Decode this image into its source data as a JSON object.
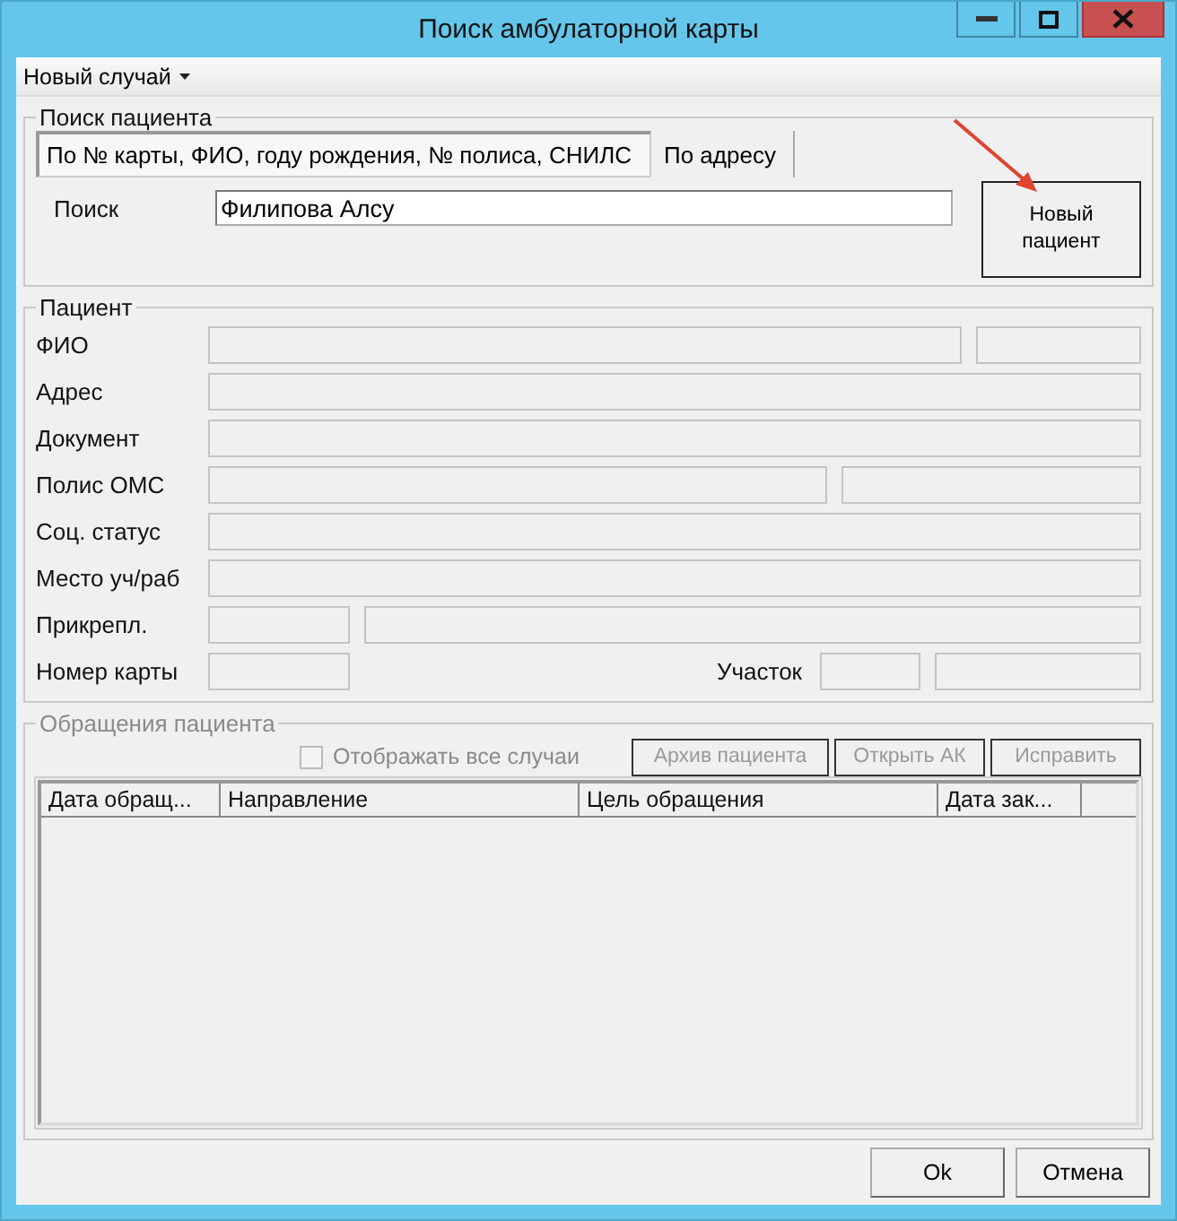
{
  "window": {
    "title": "Поиск амбулаторной карты"
  },
  "menu": [
    {
      "label": "Новый случай",
      "has_dropdown": true
    }
  ],
  "search": {
    "group_title": "Поиск пациента",
    "tabs": [
      {
        "label": "По № карты, ФИО, году рождения, № полиса, СНИЛС",
        "selected": true
      },
      {
        "label": "По адресу",
        "selected": false
      }
    ],
    "field_label": "Поиск",
    "value": "Филипова Алсу",
    "new_patient_button": "Новый\nпациент"
  },
  "patient": {
    "group_title": "Пациент",
    "rows": [
      {
        "kind": "split_wide",
        "label": "ФИО"
      },
      {
        "kind": "full",
        "label": "Адрес"
      },
      {
        "kind": "full",
        "label": "Документ"
      },
      {
        "kind": "split_half",
        "label": "Полис ОМС"
      },
      {
        "kind": "full",
        "label": "Соц. статус"
      },
      {
        "kind": "full",
        "label": "Место уч/раб"
      },
      {
        "kind": "attach",
        "label": "Прикрепл."
      },
      {
        "kind": "card",
        "label": "Номер карты",
        "second_label": "Участок"
      }
    ]
  },
  "appeals": {
    "group_title": "Обращения пациента",
    "disabled": true,
    "show_all": {
      "label": "Отображать все случаи",
      "checked": false,
      "disabled": true
    },
    "buttons": [
      {
        "label": "Архив пациента",
        "disabled": true
      },
      {
        "label": "Открыть АК",
        "disabled": true
      },
      {
        "label": "Исправить",
        "disabled": true
      }
    ],
    "table": {
      "columns": [
        "Дата обращ...",
        "Направление",
        "Цель обращения",
        "Дата зак..."
      ]
    }
  },
  "footer_buttons": [
    "Ok",
    "Отмена"
  ]
}
